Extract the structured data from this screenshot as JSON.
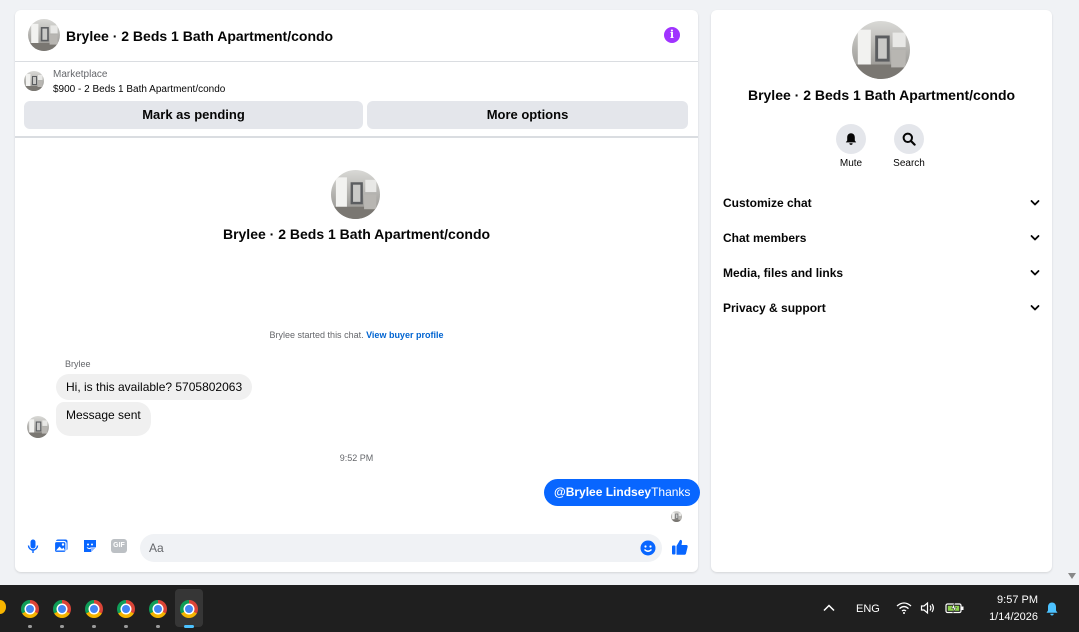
{
  "chat": {
    "title": "Brylee · 2 Beds 1 Bath Apartment/condo",
    "info_icon": "info-icon",
    "marketplace": {
      "label": "Marketplace",
      "listing": "$900 - 2 Beds 1 Bath Apartment/condo",
      "mark_pending": "Mark as pending",
      "more_options": "More options"
    },
    "intro_title": "Brylee · 2 Beds 1 Bath Apartment/condo",
    "started_text": "Brylee started this chat.",
    "view_buyer_profile": "View buyer profile",
    "sender_name": "Brylee",
    "messages_in": [
      "Hi, is this available? 5705802063",
      "Message sent"
    ],
    "timestamp": "9:52 PM",
    "message_out": {
      "mention": "@Brylee Lindsey",
      "text": "Thanks"
    },
    "composer_placeholder": "Aa",
    "composer_icons": [
      "microphone-icon",
      "photo-icon",
      "sticker-icon",
      "gif-icon",
      "emoji-icon",
      "thumbs-up-icon"
    ],
    "gif_label": "GIF"
  },
  "info_panel": {
    "title": "Brylee · 2 Beds 1 Bath Apartment/condo",
    "mute_label": "Mute",
    "search_label": "Search",
    "sections": [
      "Customize chat",
      "Chat members",
      "Media, files and links",
      "Privacy & support"
    ]
  },
  "taskbar": {
    "lang": "ENG",
    "time": "9:57 PM",
    "date": "1/14/2026",
    "apps": [
      "chrome-icon",
      "chrome-icon",
      "chrome-icon",
      "chrome-icon",
      "chrome-icon",
      "chrome-icon"
    ]
  },
  "colors": {
    "accent": "#0866ff",
    "info_purple": "#a033ff",
    "bubble_in": "#f0f0f0",
    "panel_bg": "#f0f2f5"
  }
}
